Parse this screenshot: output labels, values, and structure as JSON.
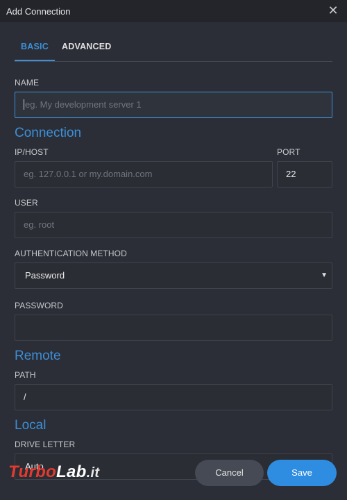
{
  "window": {
    "title": "Add Connection",
    "close_icon": "close-icon"
  },
  "tabs": [
    {
      "label": "BASIC",
      "active": true
    },
    {
      "label": "ADVANCED",
      "active": false
    }
  ],
  "name": {
    "label": "NAME",
    "placeholder": "eg. My development server 1"
  },
  "connection": {
    "section": "Connection",
    "host": {
      "label": "IP/HOST",
      "placeholder": "eg. 127.0.0.1 or my.domain.com"
    },
    "port": {
      "label": "PORT",
      "value": "22"
    },
    "user": {
      "label": "USER",
      "placeholder": "eg. root"
    },
    "auth": {
      "label": "AUTHENTICATION METHOD",
      "value": "Password"
    },
    "password": {
      "label": "PASSWORD",
      "value": ""
    }
  },
  "remote": {
    "section": "Remote",
    "path": {
      "label": "PATH",
      "value": "/"
    }
  },
  "local": {
    "section": "Local",
    "drive": {
      "label": "DRIVE LETTER",
      "value": "Auto"
    }
  },
  "buttons": {
    "cancel": "Cancel",
    "save": "Save"
  },
  "watermark": {
    "part1": "Turbo",
    "part2": "Lab",
    "part3": ".it"
  },
  "colors": {
    "accent": "#3d8fd8",
    "background": "#2b2e36",
    "save_button": "#2e8de0"
  }
}
